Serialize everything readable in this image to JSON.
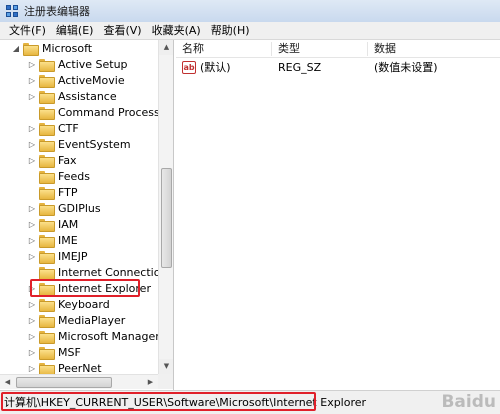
{
  "window": {
    "title": "注册表编辑器"
  },
  "menu": [
    "文件(F)",
    "编辑(E)",
    "查看(V)",
    "收藏夹(A)",
    "帮助(H)"
  ],
  "tree": {
    "root": {
      "label": "Microsoft",
      "expander": "◢"
    },
    "items": [
      "Active Setup",
      "ActiveMovie",
      "Assistance",
      "Command Processor",
      "CTF",
      "EventSystem",
      "Fax",
      "Feeds",
      "FTP",
      "GDIPlus",
      "IAM",
      "IME",
      "IMEJP",
      "Internet Connection W",
      "Internet Explorer",
      "Keyboard",
      "MediaPlayer",
      "Microsoft Managemer",
      "MSF",
      "PeerNet"
    ],
    "no_expander": [
      "Command Processor",
      "Feeds",
      "FTP",
      "Internet Connection W"
    ],
    "selected": "Internet Explorer",
    "expander_glyph": "▷"
  },
  "values": {
    "headers": {
      "name": "名称",
      "type": "类型",
      "data": "数据"
    },
    "rows": [
      {
        "icon": "ab",
        "name": "(默认)",
        "type": "REG_SZ",
        "data": "(数值未设置)"
      }
    ]
  },
  "status": {
    "path": "计算机\\HKEY_CURRENT_USER\\Software\\Microsoft\\Internet Explorer"
  },
  "watermark": "Baidu",
  "colors": {
    "highlight": "#e0202a",
    "folder": "#e7b640"
  }
}
